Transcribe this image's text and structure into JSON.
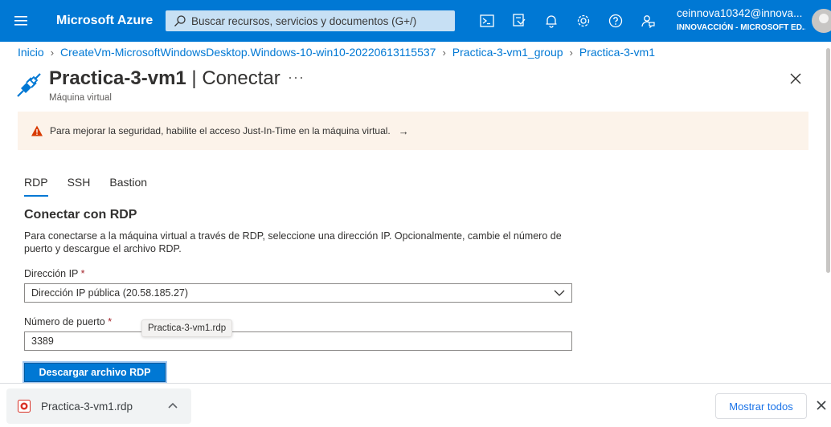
{
  "topbar": {
    "brand": "Microsoft Azure",
    "search_placeholder": "Buscar recursos, servicios y documentos (G+/)",
    "icons": [
      "cloud-shell-icon",
      "directory-filter-icon",
      "notifications-icon",
      "settings-icon",
      "help-icon",
      "feedback-icon"
    ],
    "account_name": "ceinnova10342@innova...",
    "account_org": "INNOVACCIÓN - MICROSOFT ED..."
  },
  "breadcrumb": [
    "Inicio",
    "CreateVm-MicrosoftWindowsDesktop.Windows-10-win10-20220613115537",
    "Practica-3-vm1_group",
    "Practica-3-vm1"
  ],
  "header": {
    "title_bold": "Practica-3-vm1",
    "title_rest": " | Conectar",
    "subtitle": "Máquina virtual",
    "more": "···"
  },
  "banner": {
    "text": "Para mejorar la seguridad, habilite el acceso Just-In-Time en la máquina virtual.",
    "arrow": "→"
  },
  "tabs": [
    {
      "label": "RDP",
      "active": true
    },
    {
      "label": "SSH",
      "active": false
    },
    {
      "label": "Bastion",
      "active": false
    }
  ],
  "rdp": {
    "section_title": "Conectar con RDP",
    "description": "Para conectarse a la máquina virtual a través de RDP, seleccione una dirección IP. Opcionalmente, cambie el número de puerto y descargue el archivo RDP.",
    "ip_label": "Dirección IP",
    "ip_value": "Dirección IP pública (20.58.185.27)",
    "port_label": "Número de puerto",
    "port_value": "3389",
    "required_mark": "*",
    "tooltip": "Practica-3-vm1.rdp",
    "download_button": "Descargar archivo RDP"
  },
  "download_shelf": {
    "file_name": "Practica-3-vm1.rdp",
    "show_all": "Mostrar todos"
  },
  "colors": {
    "azure_blue": "#0078d4",
    "banner_bg": "#fcf3ea",
    "warning": "#d83b01"
  }
}
